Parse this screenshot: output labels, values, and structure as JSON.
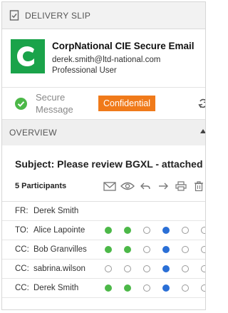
{
  "titlebar": {
    "title": "DELIVERY SLIP",
    "icon": "receipt-check-icon"
  },
  "header": {
    "app_name": "CorpNational CIE Secure Email",
    "email": "derek.smith@ltd-national.com",
    "role": "Professional User",
    "logo_color": "#1aa34a"
  },
  "status": {
    "line1": "Secure",
    "line2": "Message",
    "badge": "Confidential",
    "badge_color": "#f07a1a",
    "check_color": "#4cb848"
  },
  "section": {
    "label": "OVERVIEW"
  },
  "subject": "Subject: Please review BGXL - attached",
  "participants_label": "5 Participants",
  "actions": [
    "envelope-icon",
    "eye-icon",
    "reply-icon",
    "forward-icon",
    "print-icon",
    "delete-icon"
  ],
  "participants": [
    {
      "role": "FR:",
      "name": "Derek Smith",
      "dots": []
    },
    {
      "role": "TO:",
      "name": "Alice Lapointe",
      "dots": [
        "green",
        "green",
        "empty",
        "blue",
        "empty",
        "empty"
      ]
    },
    {
      "role": "CC:",
      "name": "Bob Granvilles",
      "dots": [
        "green",
        "green",
        "empty",
        "blue",
        "empty",
        "empty"
      ]
    },
    {
      "role": "CC:",
      "name": "sabrina.wilson",
      "dots": [
        "empty",
        "empty",
        "empty",
        "blue",
        "empty",
        "empty"
      ]
    },
    {
      "role": "CC:",
      "name": "Derek Smith",
      "dots": [
        "green",
        "green",
        "empty",
        "blue",
        "empty",
        "empty"
      ]
    }
  ]
}
